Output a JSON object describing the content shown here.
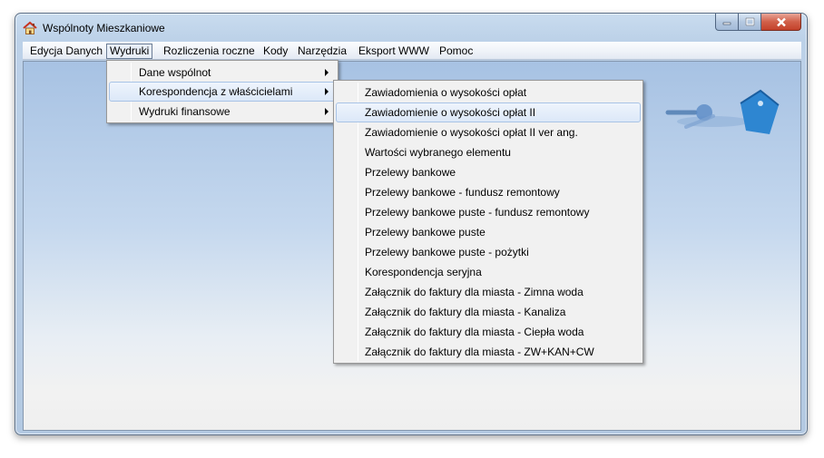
{
  "window": {
    "title": "Wspólnoty Mieszkaniowe",
    "icon": "house-icon"
  },
  "menubar": {
    "items": [
      {
        "label": "Edycja Danych"
      },
      {
        "label": "Wydruki"
      },
      {
        "label": "Rozliczenia roczne"
      },
      {
        "label": "Kody"
      },
      {
        "label": "Narzędzia"
      },
      {
        "label": "Eksport WWW"
      },
      {
        "label": "Pomoc"
      }
    ],
    "active": "Wydruki"
  },
  "wydruki_menu": {
    "items": [
      {
        "label": "Dane wspólnot"
      },
      {
        "label": "Korespondencja z właścicielami"
      },
      {
        "label": "Wydruki finansowe"
      }
    ],
    "highlighted": "Korespondencja z właścicielami"
  },
  "korespondencja_menu": {
    "items": [
      {
        "label": "Zawiadomienia o wysokości opłat"
      },
      {
        "label": "Zawiadomienie o wysokości opłat II"
      },
      {
        "label": "Zawiadomienie o wysokości opłat II ver ang."
      },
      {
        "label": "Wartości wybranego elementu"
      },
      {
        "label": "Przelewy bankowe"
      },
      {
        "label": "Przelewy bankowe - fundusz remontowy"
      },
      {
        "label": "Przelewy bankowe puste - fundusz remontowy"
      },
      {
        "label": "Przelewy bankowe puste"
      },
      {
        "label": "Przelewy bankowe puste - pożytki"
      },
      {
        "label": "Korespondencja seryjna"
      },
      {
        "label": "Załącznik do faktury dla miasta - Zimna woda"
      },
      {
        "label": "Załącznik do faktury dla miasta - Kanaliza"
      },
      {
        "label": "Załącznik do faktury dla miasta - Ciepła woda"
      },
      {
        "label": "Załącznik do faktury dla miasta - ZW+KAN+CW"
      }
    ],
    "highlighted": "Zawiadomienie o wysokości opłat II"
  },
  "colors": {
    "highlight_border": "#a8c3e6",
    "menu_bg": "#f1f1f1",
    "close_button": "#c3412a"
  }
}
